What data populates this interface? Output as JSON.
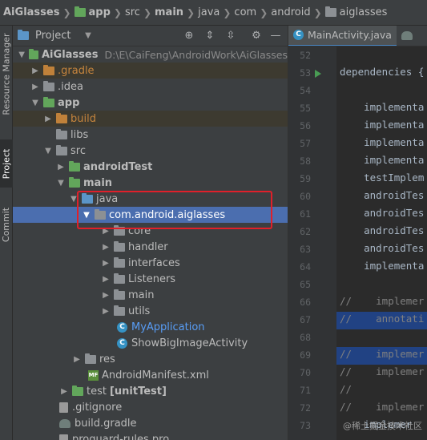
{
  "breadcrumb": {
    "items": [
      "AiGlasses",
      "app",
      "src",
      "main",
      "java",
      "com",
      "android",
      "aiglasses"
    ]
  },
  "toolstrip": {
    "tabs": [
      "Resource Manager",
      "Project",
      "Commit"
    ]
  },
  "project_panel": {
    "title": "Project",
    "tree": [
      {
        "label": "AiGlasses",
        "hint": "D:\\E\\CaiFeng\\AndroidWork\\AiGlasses"
      },
      {
        "label": ".gradle"
      },
      {
        "label": ".idea"
      },
      {
        "label": "app"
      },
      {
        "label": "build"
      },
      {
        "label": "libs"
      },
      {
        "label": "src"
      },
      {
        "label": "androidTest"
      },
      {
        "label": "main"
      },
      {
        "label": "java"
      },
      {
        "label": "com.android.aiglasses"
      },
      {
        "label": "core"
      },
      {
        "label": "handler"
      },
      {
        "label": "interfaces"
      },
      {
        "label": "Listeners"
      },
      {
        "label": "main"
      },
      {
        "label": "utils"
      },
      {
        "label": "MyApplication"
      },
      {
        "label": "ShowBigImageActivity"
      },
      {
        "label": "res"
      },
      {
        "label": "AndroidManifest.xml"
      },
      {
        "label": "test",
        "suffix": "[unitTest]"
      },
      {
        "label": ".gitignore"
      },
      {
        "label": "build.gradle"
      },
      {
        "label": "proguard-rules.pro"
      }
    ]
  },
  "editor": {
    "tab": "MainActivity.java",
    "line_numbers": [
      "52",
      "53",
      "54",
      "55",
      "56",
      "57",
      "58",
      "59",
      "60",
      "61",
      "62",
      "63",
      "64",
      "65",
      "66",
      "67",
      "68",
      "69",
      "70",
      "71",
      "72",
      "73"
    ],
    "lines": [
      "",
      "dependencies {",
      "",
      "    implementa",
      "    implementa",
      "    implementa",
      "    implementa",
      "    testImplem",
      "    androidTes",
      "    androidTes",
      "    androidTes",
      "    androidTes",
      "    implementa",
      "",
      "//    implemer",
      "//    annotati",
      "",
      "//    implemer",
      "//    implemer",
      "//",
      "//    implemer",
      "    implemer"
    ]
  },
  "watermark": "@稀土掘金技术社区"
}
